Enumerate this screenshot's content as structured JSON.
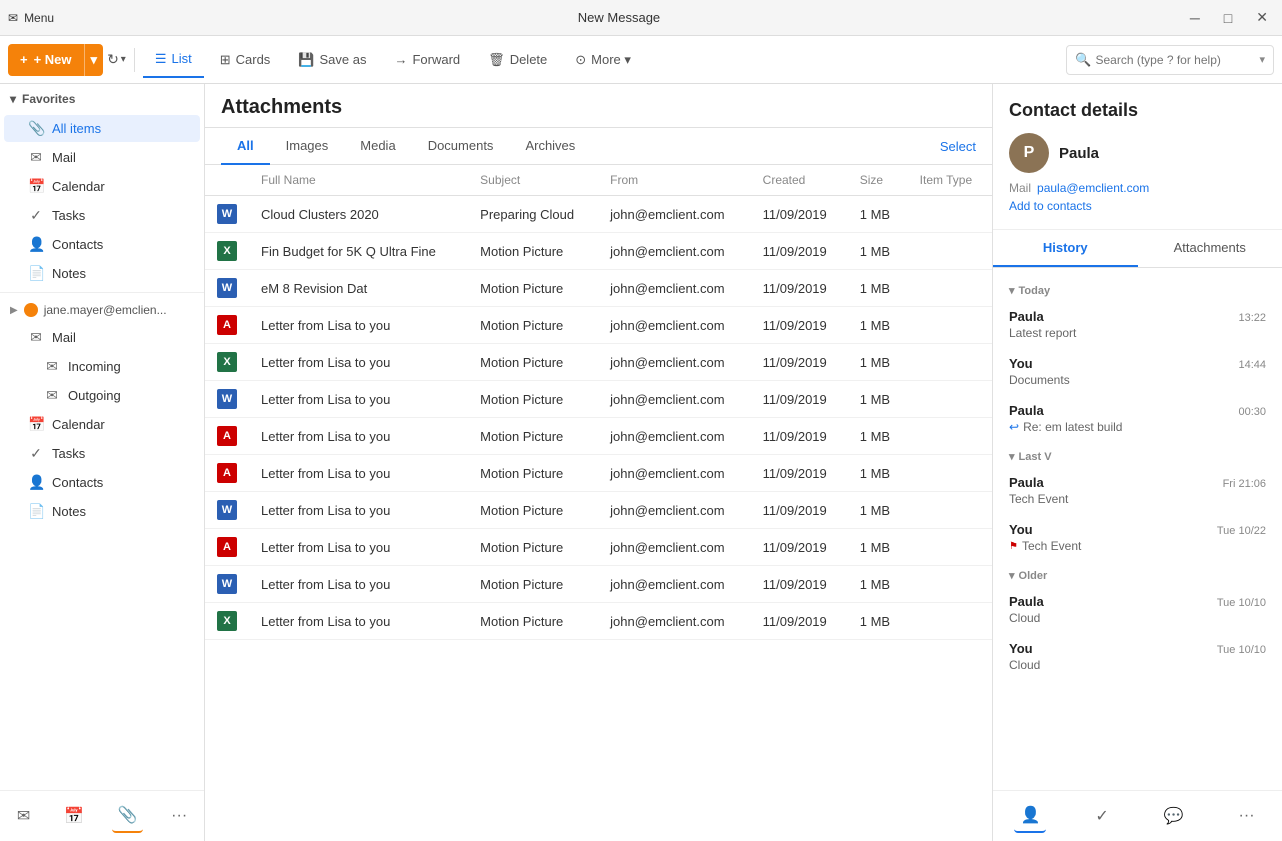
{
  "titleBar": {
    "appIcon": "✉",
    "menuLabel": "Menu",
    "title": "New Message",
    "minimizeLabel": "─",
    "maximizeLabel": "□",
    "closeLabel": "✕"
  },
  "toolbar": {
    "newLabel": "+ New",
    "newArrow": "▾",
    "refreshIcon": "↻",
    "refreshArrow": "▾",
    "tabs": [
      {
        "id": "list",
        "icon": "☰",
        "label": "List",
        "active": true
      },
      {
        "id": "cards",
        "icon": "⊞",
        "label": "Cards",
        "active": false
      },
      {
        "id": "saveas",
        "icon": "💾",
        "label": "Save as",
        "active": false
      },
      {
        "id": "forward",
        "icon": "→",
        "label": "Forward",
        "active": false
      },
      {
        "id": "delete",
        "icon": "🗑",
        "label": "Delete",
        "active": false
      },
      {
        "id": "more",
        "icon": "⊙",
        "label": "More ▾",
        "active": false
      }
    ],
    "searchPlaceholder": "Search (type ? for help)"
  },
  "sidebar": {
    "sectionFavorites": "Favorites",
    "allItemsLabel": "All items",
    "items1": [
      {
        "id": "mail1",
        "icon": "✉",
        "label": "Mail"
      },
      {
        "id": "calendar1",
        "icon": "📅",
        "label": "Calendar"
      },
      {
        "id": "tasks1",
        "icon": "✓",
        "label": "Tasks"
      },
      {
        "id": "contacts1",
        "icon": "👤",
        "label": "Contacts"
      },
      {
        "id": "notes1",
        "icon": "📄",
        "label": "Notes"
      }
    ],
    "accountLabel": "jane.mayer@emclien...",
    "items2": [
      {
        "id": "mail2",
        "icon": "✉",
        "label": "Mail"
      },
      {
        "id": "incoming",
        "icon": "✉",
        "label": "Incoming",
        "sub": true
      },
      {
        "id": "outgoing",
        "icon": "✉",
        "label": "Outgoing",
        "sub": true
      },
      {
        "id": "calendar2",
        "icon": "📅",
        "label": "Calendar"
      },
      {
        "id": "tasks2",
        "icon": "✓",
        "label": "Tasks"
      },
      {
        "id": "contacts2",
        "icon": "👤",
        "label": "Contacts"
      },
      {
        "id": "notes2",
        "icon": "📄",
        "label": "Notes"
      }
    ],
    "bottomButtons": [
      {
        "id": "mail-bottom",
        "icon": "✉"
      },
      {
        "id": "calendar-bottom",
        "icon": "📅"
      },
      {
        "id": "attachments-bottom",
        "icon": "📎",
        "active": true
      },
      {
        "id": "more-bottom",
        "icon": "···"
      }
    ]
  },
  "attachments": {
    "header": "Attachments",
    "filterTabs": [
      {
        "id": "all",
        "label": "All",
        "active": true
      },
      {
        "id": "images",
        "label": "Images",
        "active": false
      },
      {
        "id": "media",
        "label": "Media",
        "active": false
      },
      {
        "id": "documents",
        "label": "Documents",
        "active": false
      },
      {
        "id": "archives",
        "label": "Archives",
        "active": false
      }
    ],
    "selectLabel": "Select",
    "tableHeaders": [
      "",
      "Full Name",
      "Subject",
      "From",
      "Created",
      "Size",
      "Item Type"
    ],
    "rows": [
      {
        "id": 1,
        "iconType": "word",
        "iconLabel": "W",
        "fullName": "Cloud Clusters 2020",
        "subject": "Preparing Cloud",
        "from": "john@emclient.com",
        "created": "11/09/2019",
        "size": "1 MB",
        "itemType": ""
      },
      {
        "id": 2,
        "iconType": "excel",
        "iconLabel": "X",
        "fullName": "Fin Budget for 5K Q Ultra Fine",
        "subject": "Motion Picture",
        "from": "john@emclient.com",
        "created": "11/09/2019",
        "size": "1 MB",
        "itemType": ""
      },
      {
        "id": 3,
        "iconType": "word",
        "iconLabel": "W",
        "fullName": "eM 8 Revision Dat",
        "subject": "Motion Picture",
        "from": "john@emclient.com",
        "created": "11/09/2019",
        "size": "1 MB",
        "itemType": ""
      },
      {
        "id": 4,
        "iconType": "pdf",
        "iconLabel": "A",
        "fullName": "Letter from Lisa to you",
        "subject": "Motion Picture",
        "from": "john@emclient.com",
        "created": "11/09/2019",
        "size": "1 MB",
        "itemType": ""
      },
      {
        "id": 5,
        "iconType": "excel",
        "iconLabel": "X",
        "fullName": "Letter from Lisa to you",
        "subject": "Motion Picture",
        "from": "john@emclient.com",
        "created": "11/09/2019",
        "size": "1 MB",
        "itemType": ""
      },
      {
        "id": 6,
        "iconType": "word",
        "iconLabel": "W",
        "fullName": "Letter from Lisa to you",
        "subject": "Motion Picture",
        "from": "john@emclient.com",
        "created": "11/09/2019",
        "size": "1 MB",
        "itemType": ""
      },
      {
        "id": 7,
        "iconType": "pdf",
        "iconLabel": "A",
        "fullName": "Letter from Lisa to you",
        "subject": "Motion Picture",
        "from": "john@emclient.com",
        "created": "11/09/2019",
        "size": "1 MB",
        "itemType": ""
      },
      {
        "id": 8,
        "iconType": "pdf",
        "iconLabel": "A",
        "fullName": "Letter from Lisa to you",
        "subject": "Motion Picture",
        "from": "john@emclient.com",
        "created": "11/09/2019",
        "size": "1 MB",
        "itemType": ""
      },
      {
        "id": 9,
        "iconType": "word",
        "iconLabel": "W",
        "fullName": "Letter from Lisa to you",
        "subject": "Motion Picture",
        "from": "john@emclient.com",
        "created": "11/09/2019",
        "size": "1 MB",
        "itemType": ""
      },
      {
        "id": 10,
        "iconType": "pdf",
        "iconLabel": "A",
        "fullName": "Letter from Lisa to you",
        "subject": "Motion Picture",
        "from": "john@emclient.com",
        "created": "11/09/2019",
        "size": "1 MB",
        "itemType": ""
      },
      {
        "id": 11,
        "iconType": "word",
        "iconLabel": "W",
        "fullName": "Letter from Lisa to you",
        "subject": "Motion Picture",
        "from": "john@emclient.com",
        "created": "11/09/2019",
        "size": "1 MB",
        "itemType": ""
      },
      {
        "id": 12,
        "iconType": "excel",
        "iconLabel": "X",
        "fullName": "Letter from Lisa to you",
        "subject": "Motion Picture",
        "from": "john@emclient.com",
        "created": "11/09/2019",
        "size": "1 MB",
        "itemType": ""
      }
    ]
  },
  "contactDetails": {
    "title": "Contact details",
    "avatarInitial": "P",
    "name": "Paula",
    "mailLabel": "Mail",
    "mailValue": "paula@emclient.com",
    "addToContacts": "Add to contacts",
    "historyTab": "History",
    "attachmentsTab": "Attachments",
    "sections": [
      {
        "id": "today",
        "label": "Today",
        "items": [
          {
            "name": "Paula",
            "time": "13:22",
            "sub": "Latest report",
            "prefix": ""
          },
          {
            "name": "You",
            "time": "14:44",
            "sub": "Documents",
            "prefix": ""
          },
          {
            "name": "Paula",
            "time": "00:30",
            "sub": "Re: em latest build",
            "prefix": "reply"
          }
        ]
      },
      {
        "id": "lastV",
        "label": "Last V",
        "items": [
          {
            "name": "Paula",
            "time": "Fri 21:06",
            "sub": "Tech Event",
            "prefix": ""
          },
          {
            "name": "You",
            "time": "Tue 10/22",
            "sub": "Tech Event",
            "prefix": "flag"
          }
        ]
      },
      {
        "id": "older",
        "label": "Older",
        "items": [
          {
            "name": "Paula",
            "time": "Tue 10/10",
            "sub": "Cloud",
            "prefix": ""
          },
          {
            "name": "You",
            "time": "Tue 10/10",
            "sub": "Cloud",
            "prefix": ""
          }
        ]
      }
    ],
    "bottomButtons": [
      {
        "id": "contact-btn",
        "icon": "👤",
        "active": true
      },
      {
        "id": "tasks-btn",
        "icon": "✓",
        "active": false
      },
      {
        "id": "chat-btn",
        "icon": "💬",
        "active": false
      },
      {
        "id": "more-btn",
        "icon": "···",
        "active": false
      }
    ]
  }
}
